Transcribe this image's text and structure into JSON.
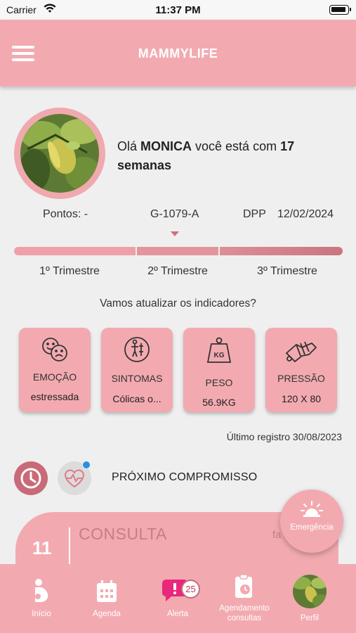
{
  "status_bar": {
    "carrier": "Carrier",
    "time": "11:37 PM"
  },
  "header": {
    "title": "MAMMYLIFE",
    "menu_icon": "hamburger-menu-icon"
  },
  "profile": {
    "greeting_prefix": "Olá ",
    "name": "MONICA",
    "greeting_middle": " você está com ",
    "weeks": "17 semanas"
  },
  "info": {
    "points": "Pontos: -",
    "code": "G-1079-A",
    "dpp_label": "DPP",
    "dpp_date": "12/02/2024"
  },
  "trimesters": [
    "1º Trimestre",
    "2º Trimestre",
    "3º Trimestre"
  ],
  "update_prompt": "Vamos atualizar os indicadores?",
  "indicators": [
    {
      "label": "EMOÇÃO",
      "value": "estressada",
      "icon": "emotion-faces-icon"
    },
    {
      "label": "SINTOMAS",
      "value": "Cólicas o...",
      "icon": "symptoms-body-icon"
    },
    {
      "label": "PESO",
      "value": "56.9KG",
      "icon": "weight-kg-icon"
    },
    {
      "label": "PRESSÃO",
      "value": "120 X 80",
      "icon": "blood-pressure-icon"
    }
  ],
  "last_record": "Último registro 30/08/2023",
  "next_appointment": {
    "title": "PRÓXIMO COMPROMISSO",
    "day": "11",
    "type": "CONSULTA",
    "extra": "fa"
  },
  "emergency": {
    "label": "Emergência"
  },
  "bottom_nav": [
    {
      "label": "Início",
      "icon": "pregnant-woman-icon"
    },
    {
      "label": "Agenda",
      "icon": "calendar-icon"
    },
    {
      "label": "Alerta",
      "icon": "alert-bubble-icon",
      "badge": "25"
    },
    {
      "label": "Agendamento consultas",
      "icon": "schedule-clipboard-icon"
    },
    {
      "label": "Perfil",
      "icon": "profile-photo-icon"
    }
  ],
  "colors": {
    "primary": "#f2aab0",
    "accent": "#c96a78",
    "background": "#efefef"
  }
}
